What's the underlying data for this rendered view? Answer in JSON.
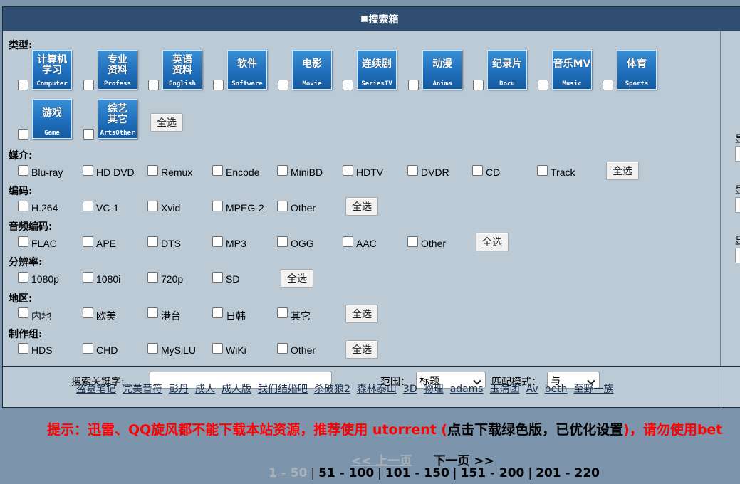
{
  "header": {
    "title": "搜索箱"
  },
  "sections": {
    "type": "类型:",
    "medium": "媒介:",
    "codec": "编码:",
    "audio": "音频编码:",
    "resolution": "分辨率:",
    "region": "地区:",
    "team": "制作组:"
  },
  "select_all": "全选",
  "categories": [
    {
      "cn": "计算机学习",
      "l1": "计算机",
      "l2": "学习",
      "en": "Computer"
    },
    {
      "cn": "专业资料",
      "l1": "专业",
      "l2": "资料",
      "en": "Profess"
    },
    {
      "cn": "英语资料",
      "l1": "英语",
      "l2": "资料",
      "en": "English"
    },
    {
      "cn": "软件",
      "l1": "软件",
      "l2": "",
      "en": "Software"
    },
    {
      "cn": "电影",
      "l1": "电影",
      "l2": "",
      "en": "Movie"
    },
    {
      "cn": "连续剧",
      "l1": "连续剧",
      "l2": "",
      "en": "SeriesTV"
    },
    {
      "cn": "动漫",
      "l1": "动漫",
      "l2": "",
      "en": "Anima"
    },
    {
      "cn": "纪录片",
      "l1": "纪录片",
      "l2": "",
      "en": "Docu"
    },
    {
      "cn": "音乐MV",
      "l1": "音乐MV",
      "l2": "",
      "en": "Music"
    },
    {
      "cn": "体育",
      "l1": "体育",
      "l2": "",
      "en": "Sports"
    },
    {
      "cn": "游戏",
      "l1": "游戏",
      "l2": "",
      "en": "Game"
    },
    {
      "cn": "综艺其它",
      "l1": "综艺",
      "l2": "其它",
      "en": "ArtsOther"
    }
  ],
  "medium": [
    "Blu-ray",
    "HD DVD",
    "Remux",
    "Encode",
    "MiniBD",
    "HDTV",
    "DVDR",
    "CD",
    "Track"
  ],
  "codec": [
    "H.264",
    "VC-1",
    "Xvid",
    "MPEG-2",
    "Other"
  ],
  "audio": [
    "FLAC",
    "APE",
    "DTS",
    "MP3",
    "OGG",
    "AAC",
    "Other"
  ],
  "resolution": [
    "1080p",
    "1080i",
    "720p",
    "SD"
  ],
  "region": [
    "内地",
    "欧美",
    "港台",
    "日韩",
    "其它"
  ],
  "team": [
    "HDS",
    "CHD",
    "MySiLU",
    "WiKi",
    "Other"
  ],
  "right_panel": {
    "label": "显"
  },
  "search": {
    "keyword_label": "搜索关键字:",
    "keyword_value": "",
    "scope_label": "范围：",
    "scope_value": "标题",
    "mode_label": "匹配模式：",
    "mode_value": "与"
  },
  "hot_keywords": [
    "盗墓笔记",
    "完美音符",
    "彭丹",
    "成人",
    "成人版",
    "我们结婚吧",
    "杀破狼2",
    "森林泰山",
    "3D",
    "物理",
    "adams",
    "玉蒲团",
    "Av",
    "beth",
    "至野一族"
  ],
  "notice": {
    "part1": "提示：迅雷、QQ旋风都不能下载本站资源，推荐使用 utorrent (",
    "part2": "点击下载绿色版，已优化设置",
    "part3": ")，请勿使用bet"
  },
  "pager": {
    "prev": "<< 上一页",
    "next": "下一页 >>",
    "pages": [
      "1 - 50",
      "51 - 100",
      "101 - 150",
      "151 - 200",
      "201 - 220"
    ]
  },
  "colors": {
    "header_bg": "#304d72",
    "panel_bg": "#bccad6",
    "page_bg": "#7d95ac",
    "notice": "#ff0000"
  }
}
